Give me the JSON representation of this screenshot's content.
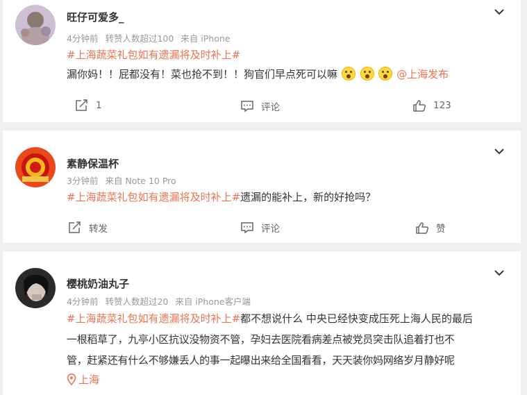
{
  "posts": [
    {
      "user": "旺仔可爱多_",
      "time": "4分钟前",
      "reposts_note": "转赞人数超过100",
      "source": "来自 iPhone",
      "hashtag": "#上海蔬菜礼包如有遗漏将及时补上#",
      "body": "漏你妈！！屁都没有！菜也抢不到！！狗官们早点死可以嘛",
      "mention": "@上海发布",
      "actions": {
        "repost": "1",
        "comment": "评论",
        "like": "123"
      }
    },
    {
      "user": "素静保温杯",
      "time": "3分钟前",
      "source": "来自 Note 10 Pro",
      "hashtag": "#上海蔬菜礼包如有遗漏将及时补上#",
      "body": "遗漏的能补上，新的好抢吗？",
      "actions": {
        "repost": "转发",
        "comment": "评论",
        "like": "赞"
      }
    },
    {
      "user": "樱桃奶油丸子",
      "time": "4分钟前",
      "reposts_note": "转赞人数超过20",
      "source": "来自 iPhone客户端",
      "hashtag": "#上海蔬菜礼包如有遗漏将及时补上#",
      "body_line1": "都不想说什么 中央已经快变成压死上海人民的最后",
      "body_line2": "一根稻草了，九亭小区抗议没物资不管，孕妇去医院看病差点被党员突击队追着打也不",
      "body_line3": "管，赶紧还有什么不够嫌丢人的事一起曝出来给全国看看，天天装你妈网络岁月静好呢",
      "location": "上海"
    }
  ],
  "icons": {
    "chevron": "chevron-down-icon",
    "repost": "repost-icon",
    "comment": "comment-icon",
    "like": "thumbs-up-icon",
    "location": "location-pin-icon",
    "emoji": "scared-face-emoji"
  },
  "colors": {
    "link": "#eb7350",
    "meta": "#999999",
    "background": "#efefef"
  }
}
